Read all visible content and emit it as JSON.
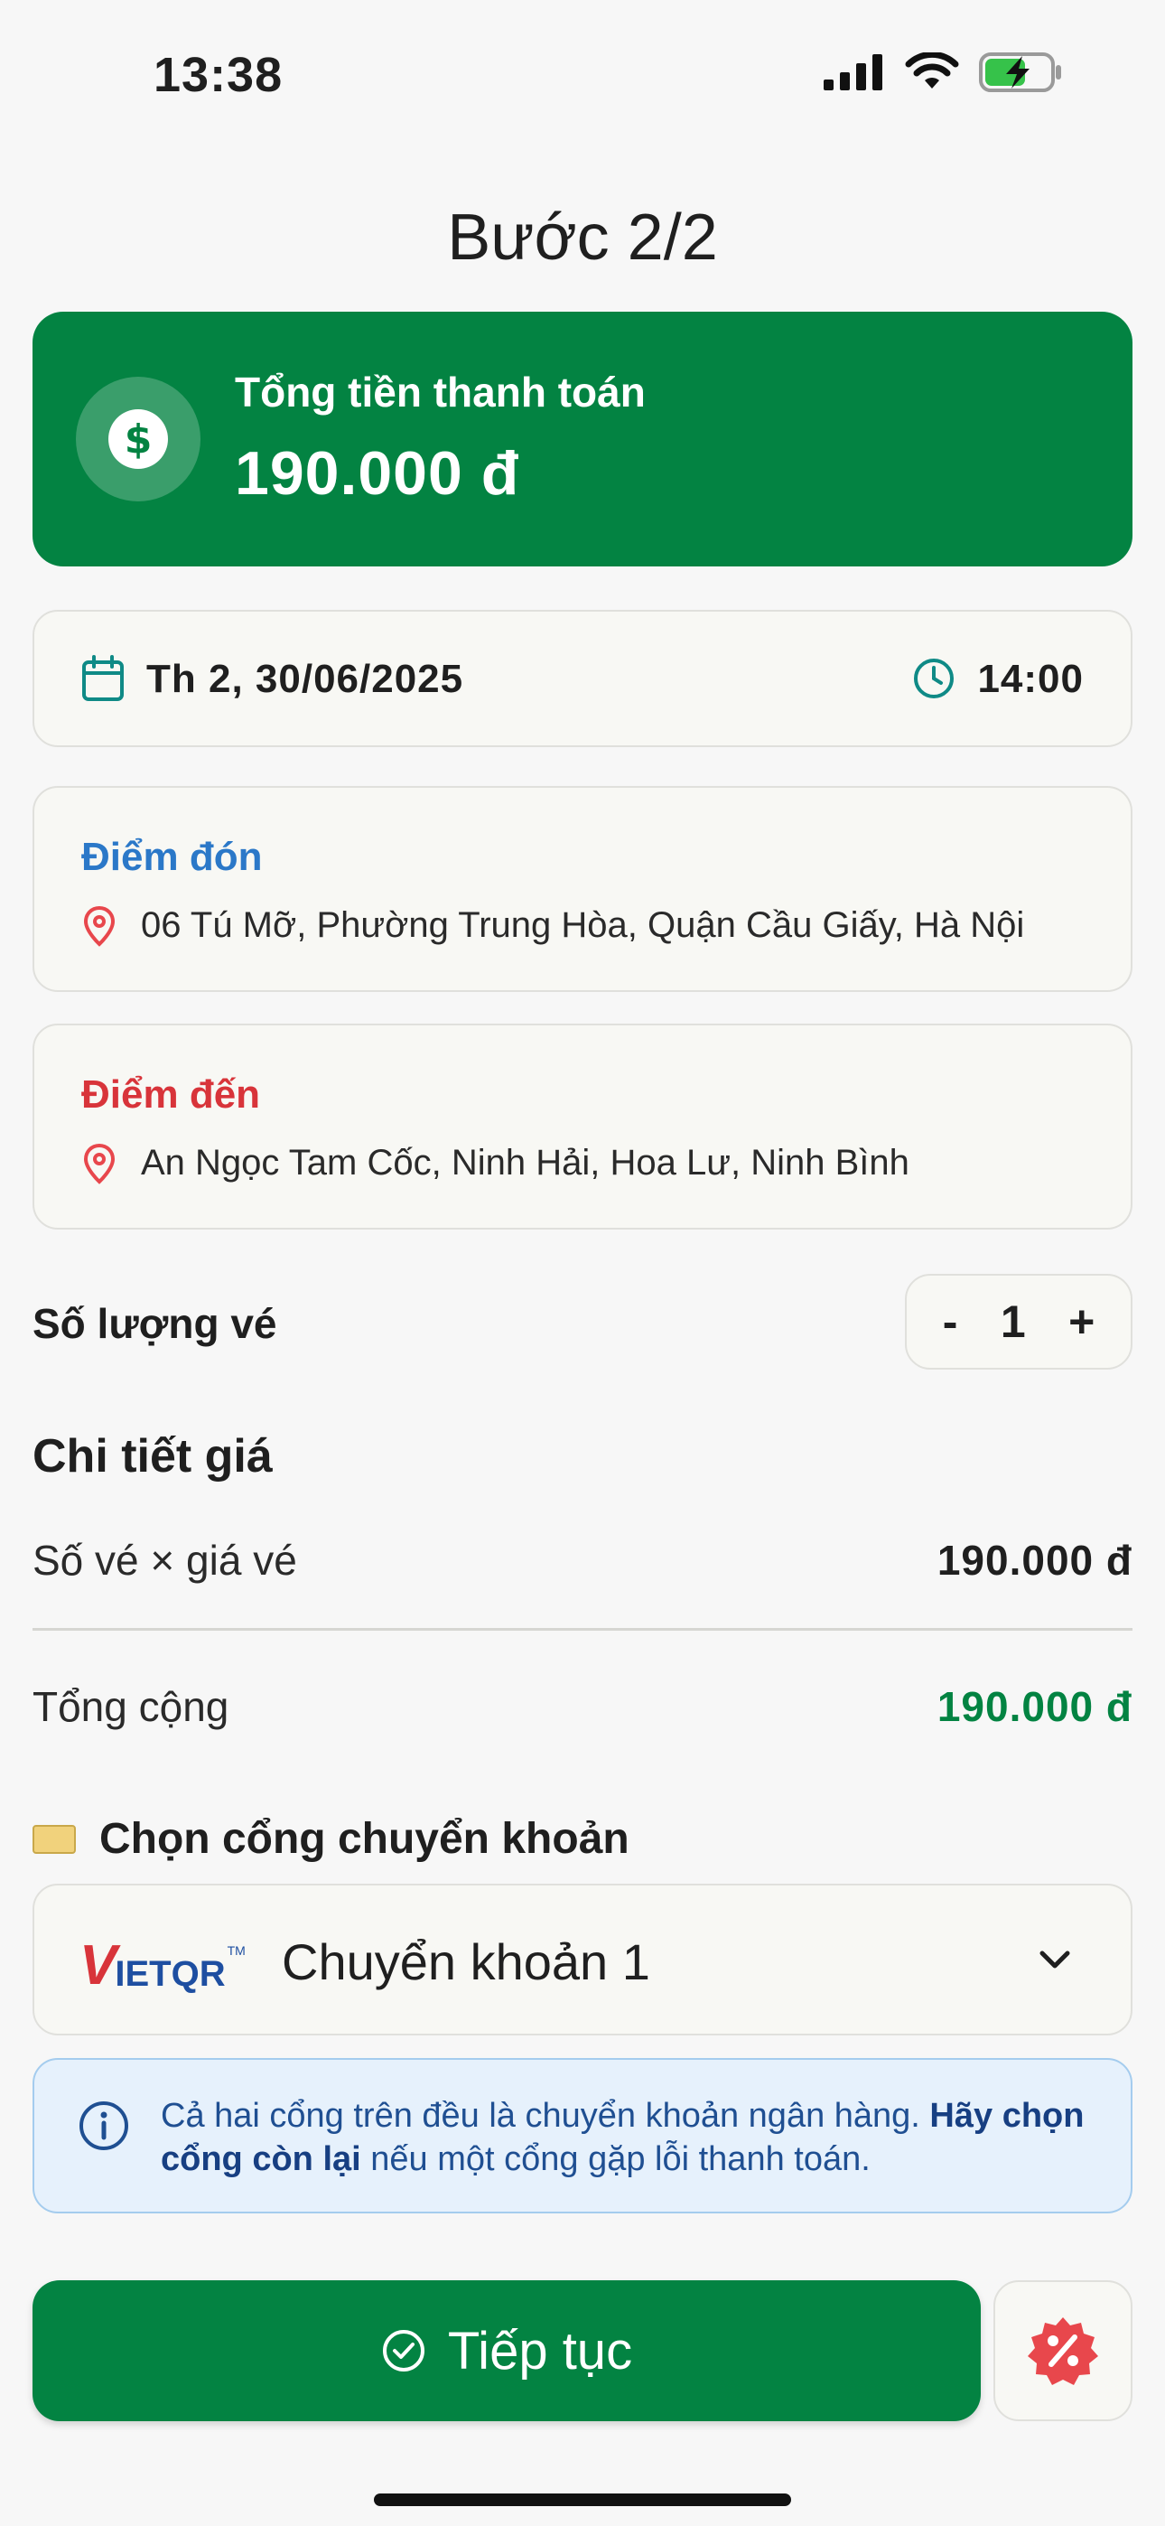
{
  "status_bar": {
    "time": "13:38"
  },
  "header": {
    "title": "Bước 2/2"
  },
  "total": {
    "label": "Tổng tiền thanh toán",
    "value": "190.000 đ",
    "icon": "dollar-circle-icon"
  },
  "schedule": {
    "date": "Th 2, 30/06/2025",
    "time": "14:00"
  },
  "pickup": {
    "title": "Điểm đón",
    "address": "06 Tú Mỡ, Phường Trung Hòa, Quận Cầu Giấy, Hà Nội"
  },
  "destination": {
    "title": "Điểm đến",
    "address": "An Ngọc Tam Cốc, Ninh Hải, Hoa Lư, Ninh Bình"
  },
  "tickets": {
    "label": "Số lượng vé",
    "minus": "-",
    "quantity": "1",
    "plus": "+"
  },
  "price_detail": {
    "heading": "Chi tiết giá",
    "line_label": "Số vé × giá vé",
    "line_value": "190.000 đ",
    "total_label": "Tổng cộng",
    "total_value": "190.000 đ"
  },
  "gateway": {
    "label": "Chọn cổng chuyển khoản",
    "logo_v": "V",
    "logo_rest": "IETQR",
    "logo_tm": "TM",
    "selected": "Chuyển khoản 1"
  },
  "info": {
    "text_1": "Cả hai cổng trên đều là chuyển khoản ngân hàng. ",
    "text_bold": "Hãy chọn cổng còn lại",
    "text_2": " nếu một cổng gặp lỗi thanh toán."
  },
  "actions": {
    "continue_label": "Tiếp tục"
  },
  "colors": {
    "primary": "#038342",
    "pickup": "#2b78c8",
    "destination": "#d8343a",
    "info_bg": "#e6f1fc"
  }
}
